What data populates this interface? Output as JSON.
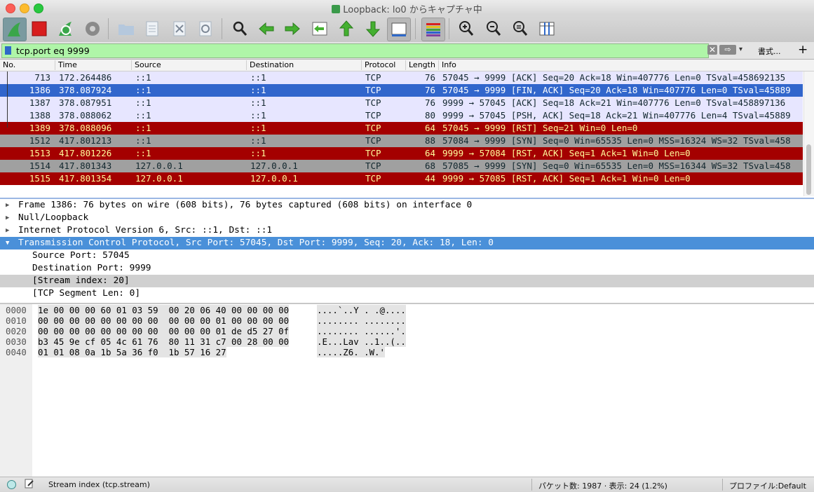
{
  "window": {
    "title": "Loopback: lo0 からキャプチャ中"
  },
  "toolbar": {
    "buttons": [
      "shark-fin-start-icon",
      "stop-icon",
      "restart-icon",
      "gear-icon",
      "folder-icon",
      "file-icon",
      "close-file-icon",
      "reload-icon",
      "search-icon",
      "arrow-left-icon",
      "arrow-right-icon",
      "jump-icon",
      "arrow-up-icon",
      "arrow-down-icon",
      "autoscroll-icon",
      "colorize-icon",
      "zoom-in-icon",
      "zoom-out-icon",
      "zoom-reset-icon",
      "resize-columns-icon"
    ]
  },
  "filter": {
    "value": "tcp.port eq 9999",
    "clear_label": "✕",
    "apply_label": "⇨",
    "drop_label": "▾",
    "format_label": "書式...",
    "add_label": "+"
  },
  "packet_list": {
    "columns": [
      "No.",
      "Time",
      "Source",
      "Destination",
      "Protocol",
      "Length",
      "Info"
    ],
    "rows": [
      {
        "no": "713",
        "time": "172.264486",
        "src": "::1",
        "dst": "::1",
        "proto": "TCP",
        "len": "76",
        "info": "57045 → 9999 [ACK] Seq=20 Ack=18 Win=407776 Len=0 TSval=458692135",
        "style": "normal"
      },
      {
        "no": "1386",
        "time": "378.087924",
        "src": "::1",
        "dst": "::1",
        "proto": "TCP",
        "len": "76",
        "info": "57045 → 9999 [FIN, ACK] Seq=20 Ack=18 Win=407776 Len=0 TSval=45889",
        "style": "selected"
      },
      {
        "no": "1387",
        "time": "378.087951",
        "src": "::1",
        "dst": "::1",
        "proto": "TCP",
        "len": "76",
        "info": "9999 → 57045 [ACK] Seq=18 Ack=21 Win=407776 Len=0 TSval=458897136",
        "style": "normal"
      },
      {
        "no": "1388",
        "time": "378.088062",
        "src": "::1",
        "dst": "::1",
        "proto": "TCP",
        "len": "80",
        "info": "9999 → 57045 [PSH, ACK] Seq=18 Ack=21 Win=407776 Len=4 TSval=45889",
        "style": "normal"
      },
      {
        "no": "1389",
        "time": "378.088096",
        "src": "::1",
        "dst": "::1",
        "proto": "TCP",
        "len": "64",
        "info": "57045 → 9999 [RST] Seq=21 Win=0 Len=0",
        "style": "rst"
      },
      {
        "no": "1512",
        "time": "417.801213",
        "src": "::1",
        "dst": "::1",
        "proto": "TCP",
        "len": "88",
        "info": "57084 → 9999 [SYN] Seq=0 Win=65535 Len=0 MSS=16324 WS=32 TSval=458",
        "style": "syn"
      },
      {
        "no": "1513",
        "time": "417.801226",
        "src": "::1",
        "dst": "::1",
        "proto": "TCP",
        "len": "64",
        "info": "9999 → 57084 [RST, ACK] Seq=1 Ack=1 Win=0 Len=0",
        "style": "rst"
      },
      {
        "no": "1514",
        "time": "417.801343",
        "src": "127.0.0.1",
        "dst": "127.0.0.1",
        "proto": "TCP",
        "len": "68",
        "info": "57085 → 9999 [SYN] Seq=0 Win=65535 Len=0 MSS=16344 WS=32 TSval=458",
        "style": "syn"
      },
      {
        "no": "1515",
        "time": "417.801354",
        "src": "127.0.0.1",
        "dst": "127.0.0.1",
        "proto": "TCP",
        "len": "44",
        "info": "9999 → 57085 [RST, ACK] Seq=1 Ack=1 Win=0 Len=0",
        "style": "rst"
      }
    ]
  },
  "details": [
    {
      "text": "Frame 1386: 76 bytes on wire (608 bits), 76 bytes captured (608 bits) on interface 0",
      "tri": "▶",
      "indent": 0,
      "style": ""
    },
    {
      "text": "Null/Loopback",
      "tri": "▶",
      "indent": 0,
      "style": ""
    },
    {
      "text": "Internet Protocol Version 6, Src: ::1, Dst: ::1",
      "tri": "▶",
      "indent": 0,
      "style": ""
    },
    {
      "text": "Transmission Control Protocol, Src Port: 57045, Dst Port: 9999, Seq: 20, Ack: 18, Len: 0",
      "tri": "▼",
      "indent": 0,
      "style": "selected"
    },
    {
      "text": "Source Port: 57045",
      "tri": "",
      "indent": 1,
      "style": ""
    },
    {
      "text": "Destination Port: 9999",
      "tri": "",
      "indent": 1,
      "style": ""
    },
    {
      "text": "[Stream index: 20]",
      "tri": "",
      "indent": 1,
      "style": "gray"
    },
    {
      "text": "[TCP Segment Len: 0]",
      "tri": "",
      "indent": 1,
      "style": ""
    }
  ],
  "bytes": [
    {
      "offset": "0000",
      "hex": "1e 00 00 00 60 01 03 59  00 20 06 40 00 00 00 00",
      "ascii": "....`..Y . .@...."
    },
    {
      "offset": "0010",
      "hex": "00 00 00 00 00 00 00 00  00 00 00 01 00 00 00 00",
      "ascii": "........ ........"
    },
    {
      "offset": "0020",
      "hex": "00 00 00 00 00 00 00 00  00 00 00 01 de d5 27 0f",
      "ascii": "........ ......'."
    },
    {
      "offset": "0030",
      "hex": "b3 45 9e cf 05 4c 61 76  80 11 31 c7 00 28 00 00",
      "ascii": ".E...Lav ..1..(.."
    },
    {
      "offset": "0040",
      "hex": "01 01 08 0a 1b 5a 36 f0  1b 57 16 27",
      "ascii": ".....Z6. .W.'"
    }
  ],
  "status": {
    "field_text": "Stream index (tcp.stream)",
    "packets": "パケット数: 1987 · 表示: 24 (1.2%)",
    "profile": "プロファイル:Default"
  },
  "colors": {
    "normal": "#e7e6ff",
    "selected": "#3166cc",
    "rst": "#a40000",
    "rst_text": "#fffc9c",
    "syn": "#a0a0a0",
    "filter_ok": "#aff5a8"
  }
}
